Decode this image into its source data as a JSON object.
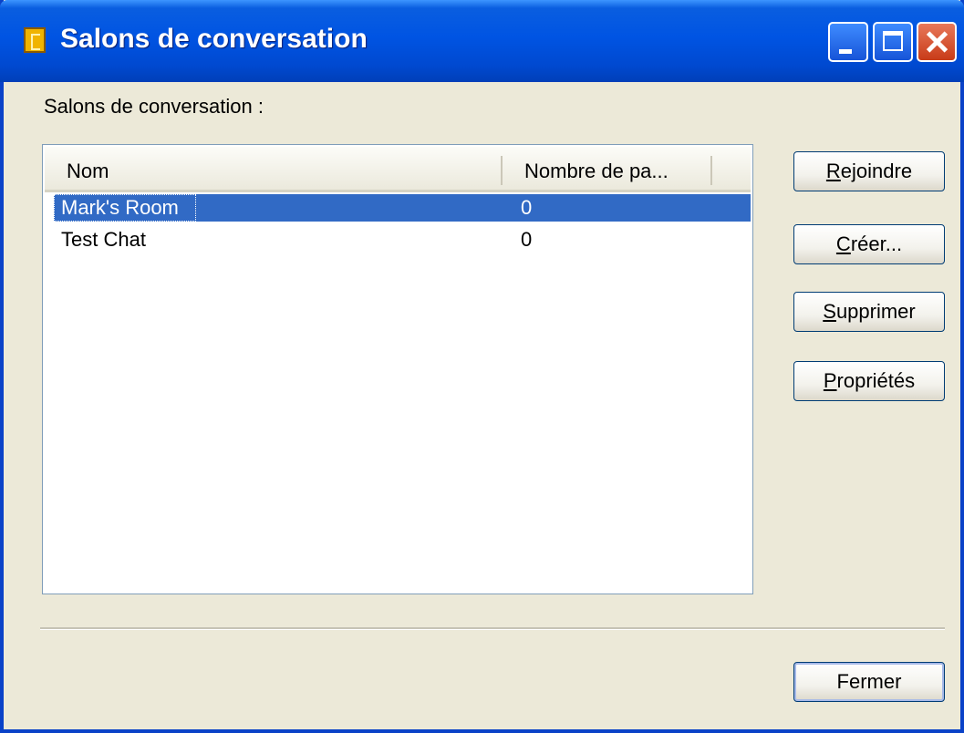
{
  "window": {
    "title": "Salons de conversation"
  },
  "label": "Salons de conversation :",
  "list": {
    "columns": [
      "Nom",
      "Nombre de pa..."
    ],
    "rows": [
      {
        "name": "Mark's Room",
        "count": "0",
        "selected": true
      },
      {
        "name": "Test Chat",
        "count": "0",
        "selected": false
      }
    ]
  },
  "buttons": {
    "join": {
      "mnemonic": "R",
      "rest": "ejoindre"
    },
    "create": {
      "mnemonic": "C",
      "rest": "réer..."
    },
    "delete": {
      "mnemonic": "S",
      "rest": "upprimer"
    },
    "properties": {
      "mnemonic": "P",
      "rest": "ropriétés"
    },
    "close": "Fermer"
  },
  "colors": {
    "selection": "#316ac5",
    "titlebar": "#0054e3"
  }
}
